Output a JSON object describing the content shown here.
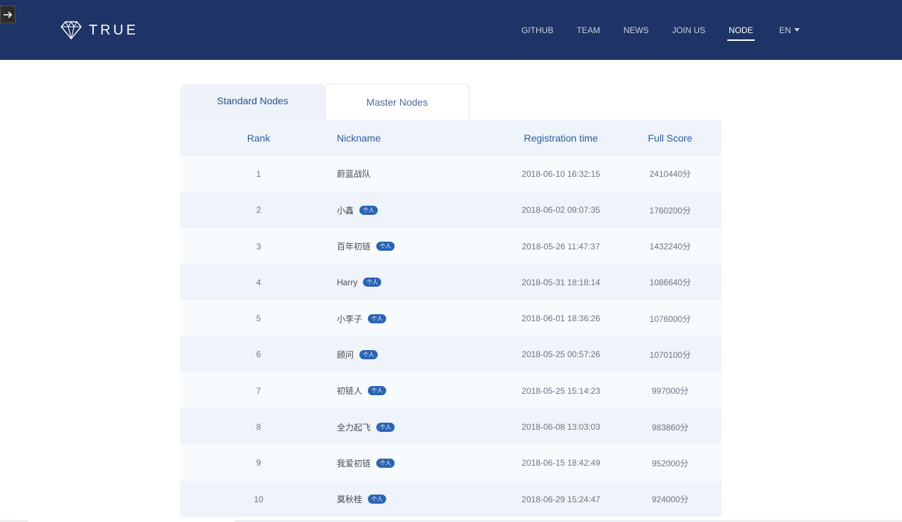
{
  "brand": {
    "name": "TRUE"
  },
  "nav": {
    "items": [
      {
        "label": "GITHUB"
      },
      {
        "label": "TEAM"
      },
      {
        "label": "NEWS"
      },
      {
        "label": "JOIN US"
      },
      {
        "label": "NODE"
      }
    ],
    "active": "NODE",
    "language": "EN"
  },
  "tabs": {
    "standard": "Standard Nodes",
    "master": "Master Nodes"
  },
  "table": {
    "headers": {
      "rank": "Rank",
      "nickname": "Nickname",
      "time": "Registration time",
      "score": "Full Score"
    },
    "badge_label": "个人",
    "rows": [
      {
        "rank": "1",
        "nickname": "蔚蓝战队",
        "badge": false,
        "time": "2018-06-10 16:32:15",
        "score": "2410440分"
      },
      {
        "rank": "2",
        "nickname": "小鑫",
        "badge": true,
        "time": "2018-06-02 09:07:35",
        "score": "1760200分"
      },
      {
        "rank": "3",
        "nickname": "百年初链",
        "badge": true,
        "time": "2018-05-26 11:47:37",
        "score": "1432240分"
      },
      {
        "rank": "4",
        "nickname": "Harry",
        "badge": true,
        "time": "2018-05-31 18:18:14",
        "score": "1086640分"
      },
      {
        "rank": "5",
        "nickname": "小李子",
        "badge": true,
        "time": "2018-06-01 18:36:26",
        "score": "1076000分"
      },
      {
        "rank": "6",
        "nickname": "顾问",
        "badge": true,
        "time": "2018-05-25 00:57:26",
        "score": "1070100分"
      },
      {
        "rank": "7",
        "nickname": "初链人",
        "badge": true,
        "time": "2018-05-25 15:14:23",
        "score": "997000分"
      },
      {
        "rank": "8",
        "nickname": "全力起飞",
        "badge": true,
        "time": "2018-06-08 13:03:03",
        "score": "983860分"
      },
      {
        "rank": "9",
        "nickname": "我爱初链",
        "badge": true,
        "time": "2018-06-15 18:42:49",
        "score": "952000分"
      },
      {
        "rank": "10",
        "nickname": "莫秋桂",
        "badge": true,
        "time": "2018-06-29 15:24:47",
        "score": "924000分"
      }
    ]
  },
  "colors": {
    "header_bg": "#1e3366",
    "accent": "#2b5da3",
    "badge": "#2a64b4"
  }
}
